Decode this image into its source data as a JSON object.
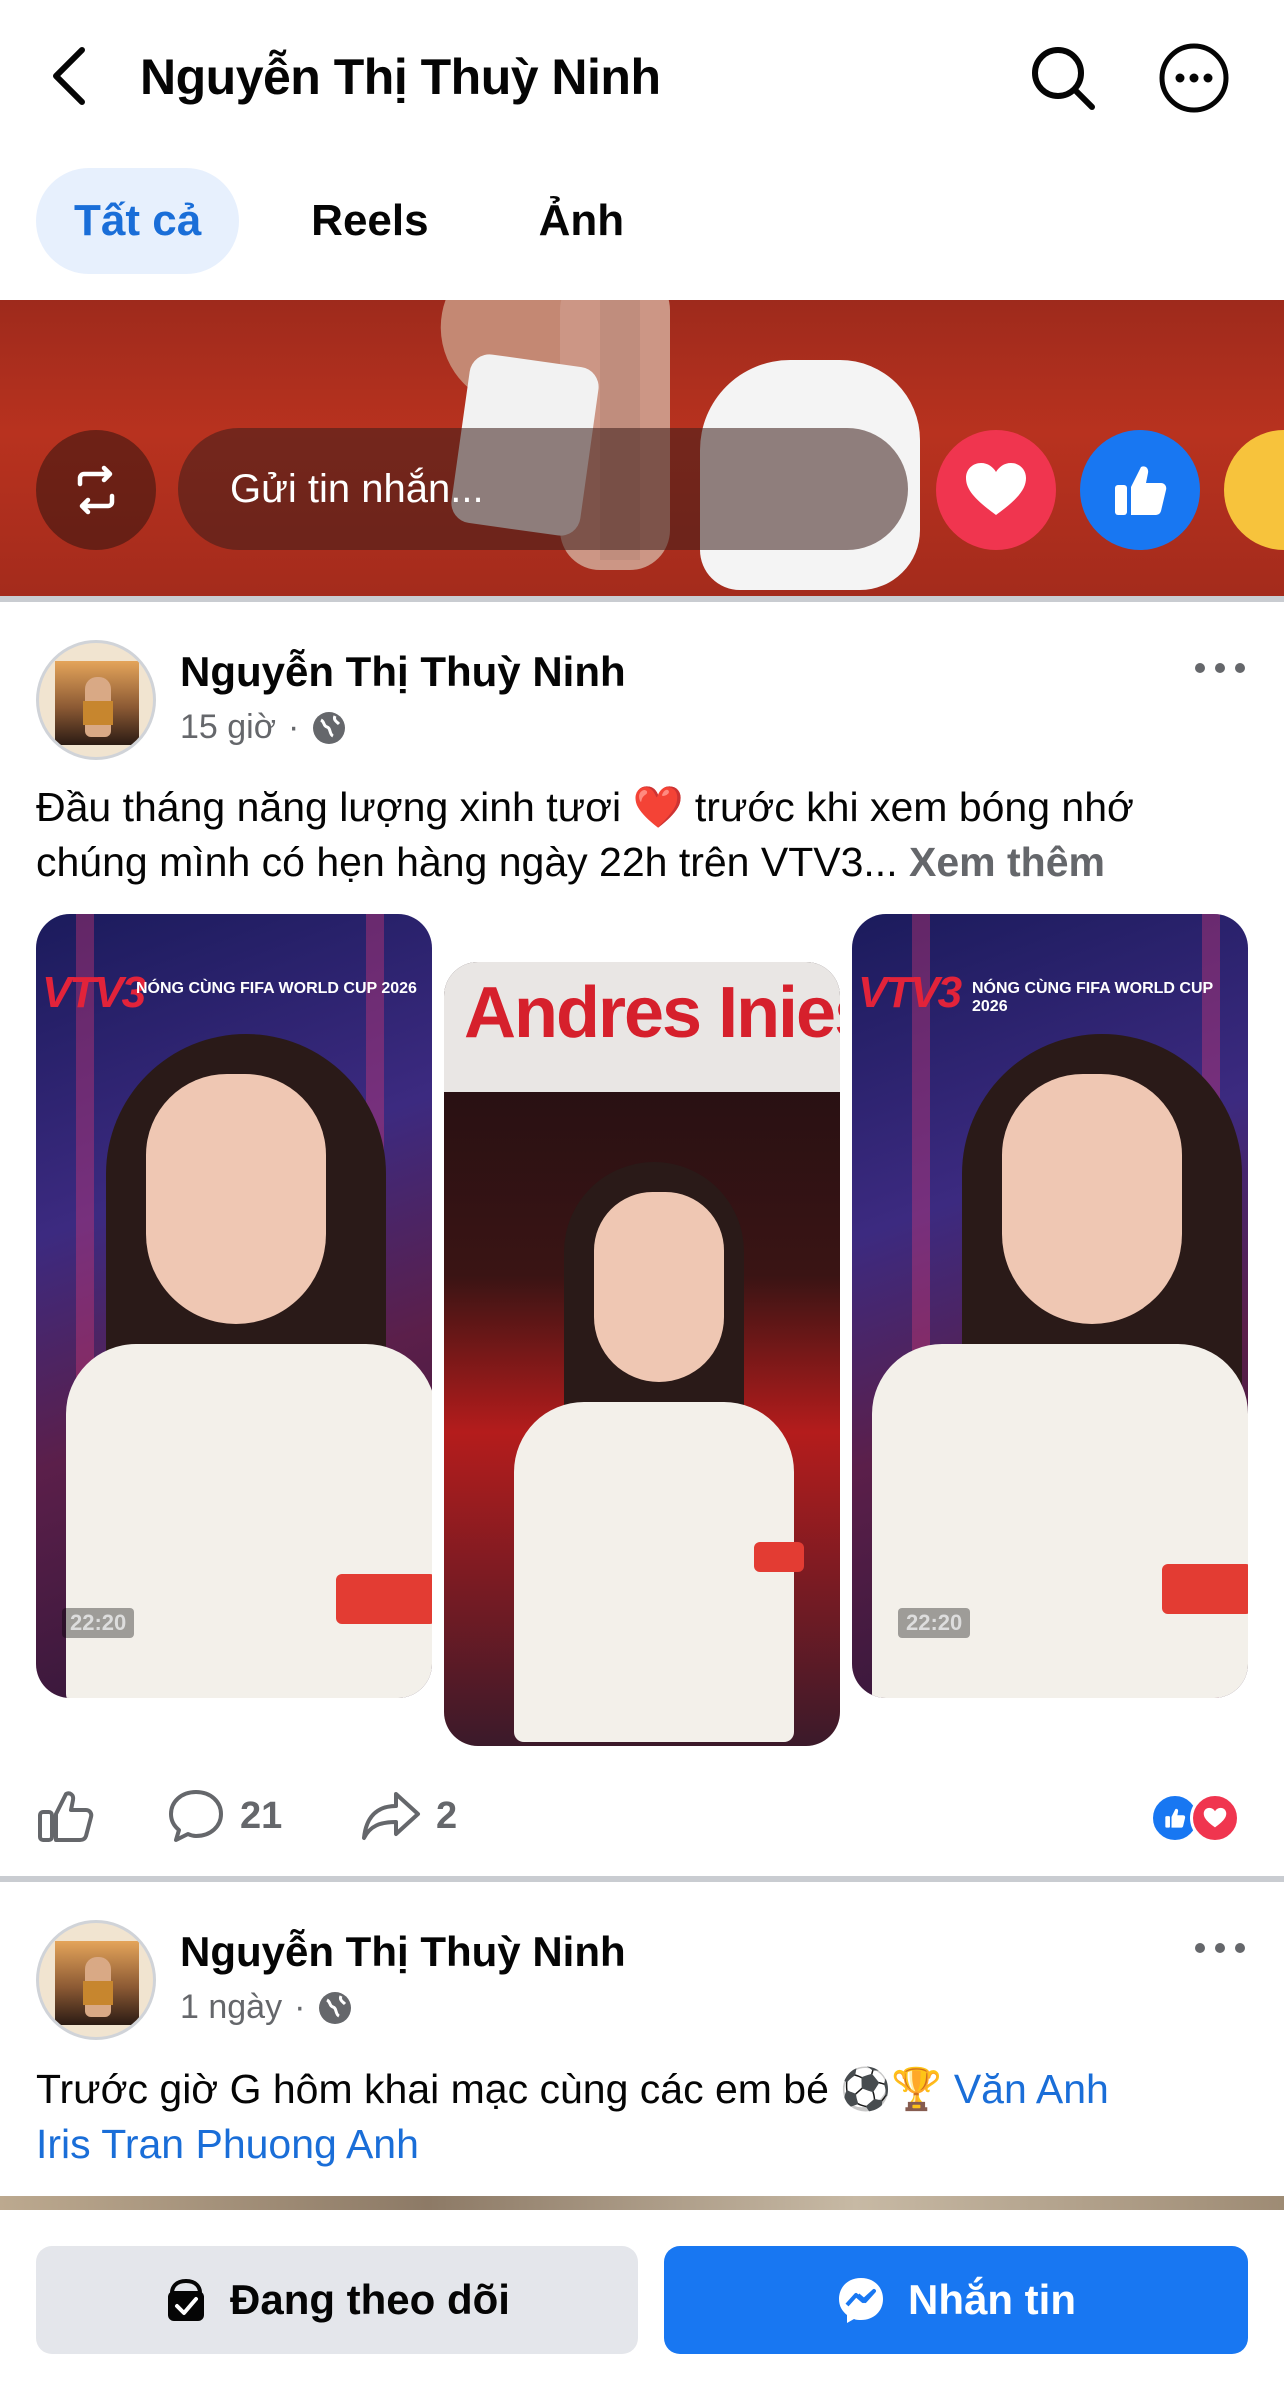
{
  "header": {
    "title": "Nguyễn Thị Thuỳ Ninh",
    "back_icon": "chevron-left-icon",
    "search_icon": "search-icon",
    "more_icon": "more-horizontal-icon"
  },
  "tabs": [
    {
      "label": "Tất cả",
      "active": true
    },
    {
      "label": "Reels",
      "active": false
    },
    {
      "label": "Ảnh",
      "active": false
    }
  ],
  "story": {
    "message_placeholder": "Gửi tin nhắn...",
    "reactions": [
      "heart",
      "like",
      "haha"
    ]
  },
  "posts": [
    {
      "author": "Nguyễn Thị Thuỳ Ninh",
      "time": "15 giờ",
      "privacy_icon": "globe-icon",
      "text_line1": "Đầu tháng năng lượng xinh tươi ❤️ trước khi xem bóng nhớ",
      "text_line2": "chúng mình có hẹn hàng ngày 22h trên VTV3...",
      "see_more": "Xem thêm",
      "photos": [
        {
          "channel": "VTV3",
          "caption": "NÓNG CÙNG FIFA WORLD CUP 2026",
          "time": "22:20"
        },
        {
          "banner": "Andres Inies"
        },
        {
          "channel": "VTV3",
          "caption": "NÓNG CÙNG FIFA WORLD CUP 2026",
          "time": "22:20"
        }
      ],
      "comments": "21",
      "shares": "2"
    },
    {
      "author": "Nguyễn Thị Thuỳ Ninh",
      "time": "1 ngày",
      "privacy_icon": "globe-icon",
      "text": "Trước giờ G hôm khai mạc cùng các em bé ⚽🏆",
      "tag1": "Văn Anh",
      "tag2": "Iris Tran Phuong Anh"
    }
  ],
  "bottom_bar": {
    "following_label": "Đang theo dõi",
    "message_label": "Nhắn tin"
  },
  "colors": {
    "accent": "#1877f2",
    "tab_active_bg": "#e7f0fd",
    "heart": "#f0354f",
    "text_secondary": "#65676b"
  }
}
